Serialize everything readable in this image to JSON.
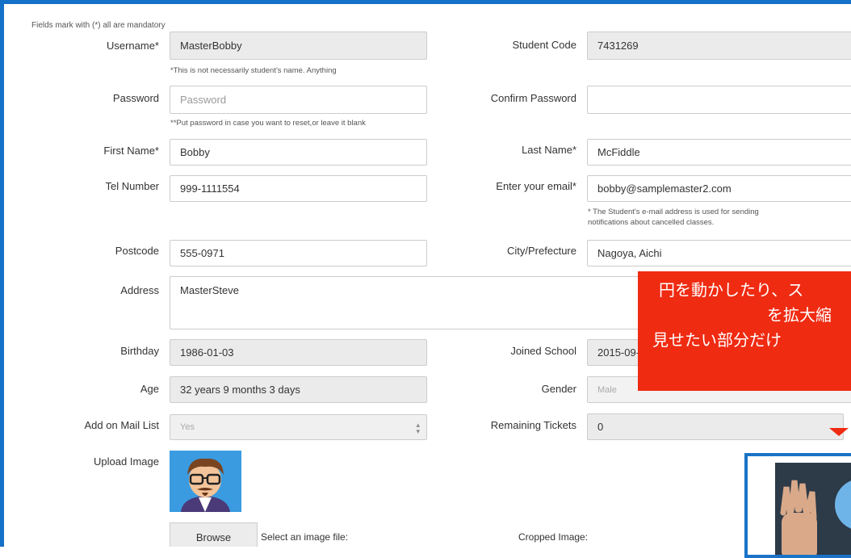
{
  "form": {
    "mandatory_note": "Fields mark with (*) all are mandatory",
    "username": {
      "label": "Username*",
      "value": "MasterBobby",
      "help": "*This is not necessarily student's name. Anything"
    },
    "student_code": {
      "label": "Student Code",
      "value": "7431269"
    },
    "password": {
      "label": "Password",
      "placeholder": "Password",
      "help": "**Put password in case you want to reset,or leave it blank"
    },
    "confirm_password": {
      "label": "Confirm Password",
      "value": ""
    },
    "first_name": {
      "label": "First Name*",
      "value": "Bobby"
    },
    "last_name": {
      "label": "Last Name*",
      "value": "McFiddle"
    },
    "tel": {
      "label": "Tel Number",
      "value": "999-1111554"
    },
    "email": {
      "label": "Enter your email*",
      "value": "bobby@samplemaster2.com",
      "help_line1": "* The Student's e-mail address is used for sending",
      "help_line2": "notifications about cancelled classes."
    },
    "postcode": {
      "label": "Postcode",
      "value": "555-0971"
    },
    "city": {
      "label": "City/Prefecture",
      "value": "Nagoya, Aichi"
    },
    "address": {
      "label": "Address",
      "value": "MasterSteve"
    },
    "birthday": {
      "label": "Birthday",
      "value": "1986-01-03"
    },
    "joined": {
      "label": "Joined School",
      "value": "2015-09-"
    },
    "age": {
      "label": "Age",
      "value": "32 years 9 months 3 days"
    },
    "gender": {
      "label": "Gender",
      "value": "Male"
    },
    "mail_list": {
      "label": "Add on Mail List",
      "value": "Yes"
    },
    "tickets": {
      "label": "Remaining Tickets",
      "value": "0"
    },
    "upload": {
      "label": "Upload Image",
      "browse": "Browse",
      "select_text": "Select an image file:",
      "cropped_text": "Cropped Image:"
    }
  },
  "overlay": {
    "line1": "円を動かしたり、ス",
    "line2": "を拡大縮",
    "line3": "見せたい部分だけ"
  },
  "colors": {
    "accent": "#1570c8",
    "overlay": "#ef2b12"
  }
}
